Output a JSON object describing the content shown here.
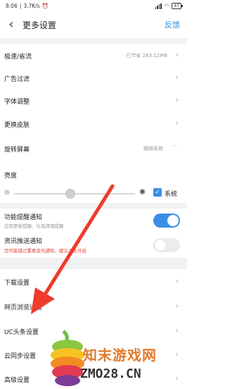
{
  "status_bar": {
    "time": "8:06",
    "speed": "3.7K/s",
    "battery": "47"
  },
  "header": {
    "back_icon": "chevron-left-icon",
    "title": "更多设置",
    "feedback": "反馈"
  },
  "rows": {
    "speed_mode": {
      "label": "极速/省流",
      "value": "已节省 263.12MB"
    },
    "ad_filter": {
      "label": "广告过滤"
    },
    "font": {
      "label": "字体调整"
    },
    "skin": {
      "label": "更换皮肤"
    },
    "rotate": {
      "label": "旋转屏幕",
      "value": "跟随系统",
      "more": "···"
    }
  },
  "brightness": {
    "label": "亮度",
    "system_label": "系统",
    "system_checked": true,
    "level": 0.46
  },
  "notify": {
    "feature": {
      "label": "功能提醒通知",
      "desc": "应用更新提醒、垃圾清理提醒",
      "on": true
    },
    "news": {
      "label": "资讯推送通知",
      "desc": "您可能错过重要资讯通知，建议点击开启",
      "on": false
    }
  },
  "rows2": {
    "download": {
      "label": "下载设置"
    },
    "web": {
      "label": "网页浏览设置"
    },
    "uc": {
      "label": "UC头条设置"
    },
    "cloud": {
      "label": "云同步设置"
    },
    "advanced": {
      "label": "高级设置"
    }
  },
  "watermark": {
    "brand": "知末游戏网",
    "domain": "ZMO28.CN"
  },
  "colors": {
    "accent": "#3a8ee6",
    "warning": "#e0443b",
    "arrow": "#ee3b2e"
  }
}
